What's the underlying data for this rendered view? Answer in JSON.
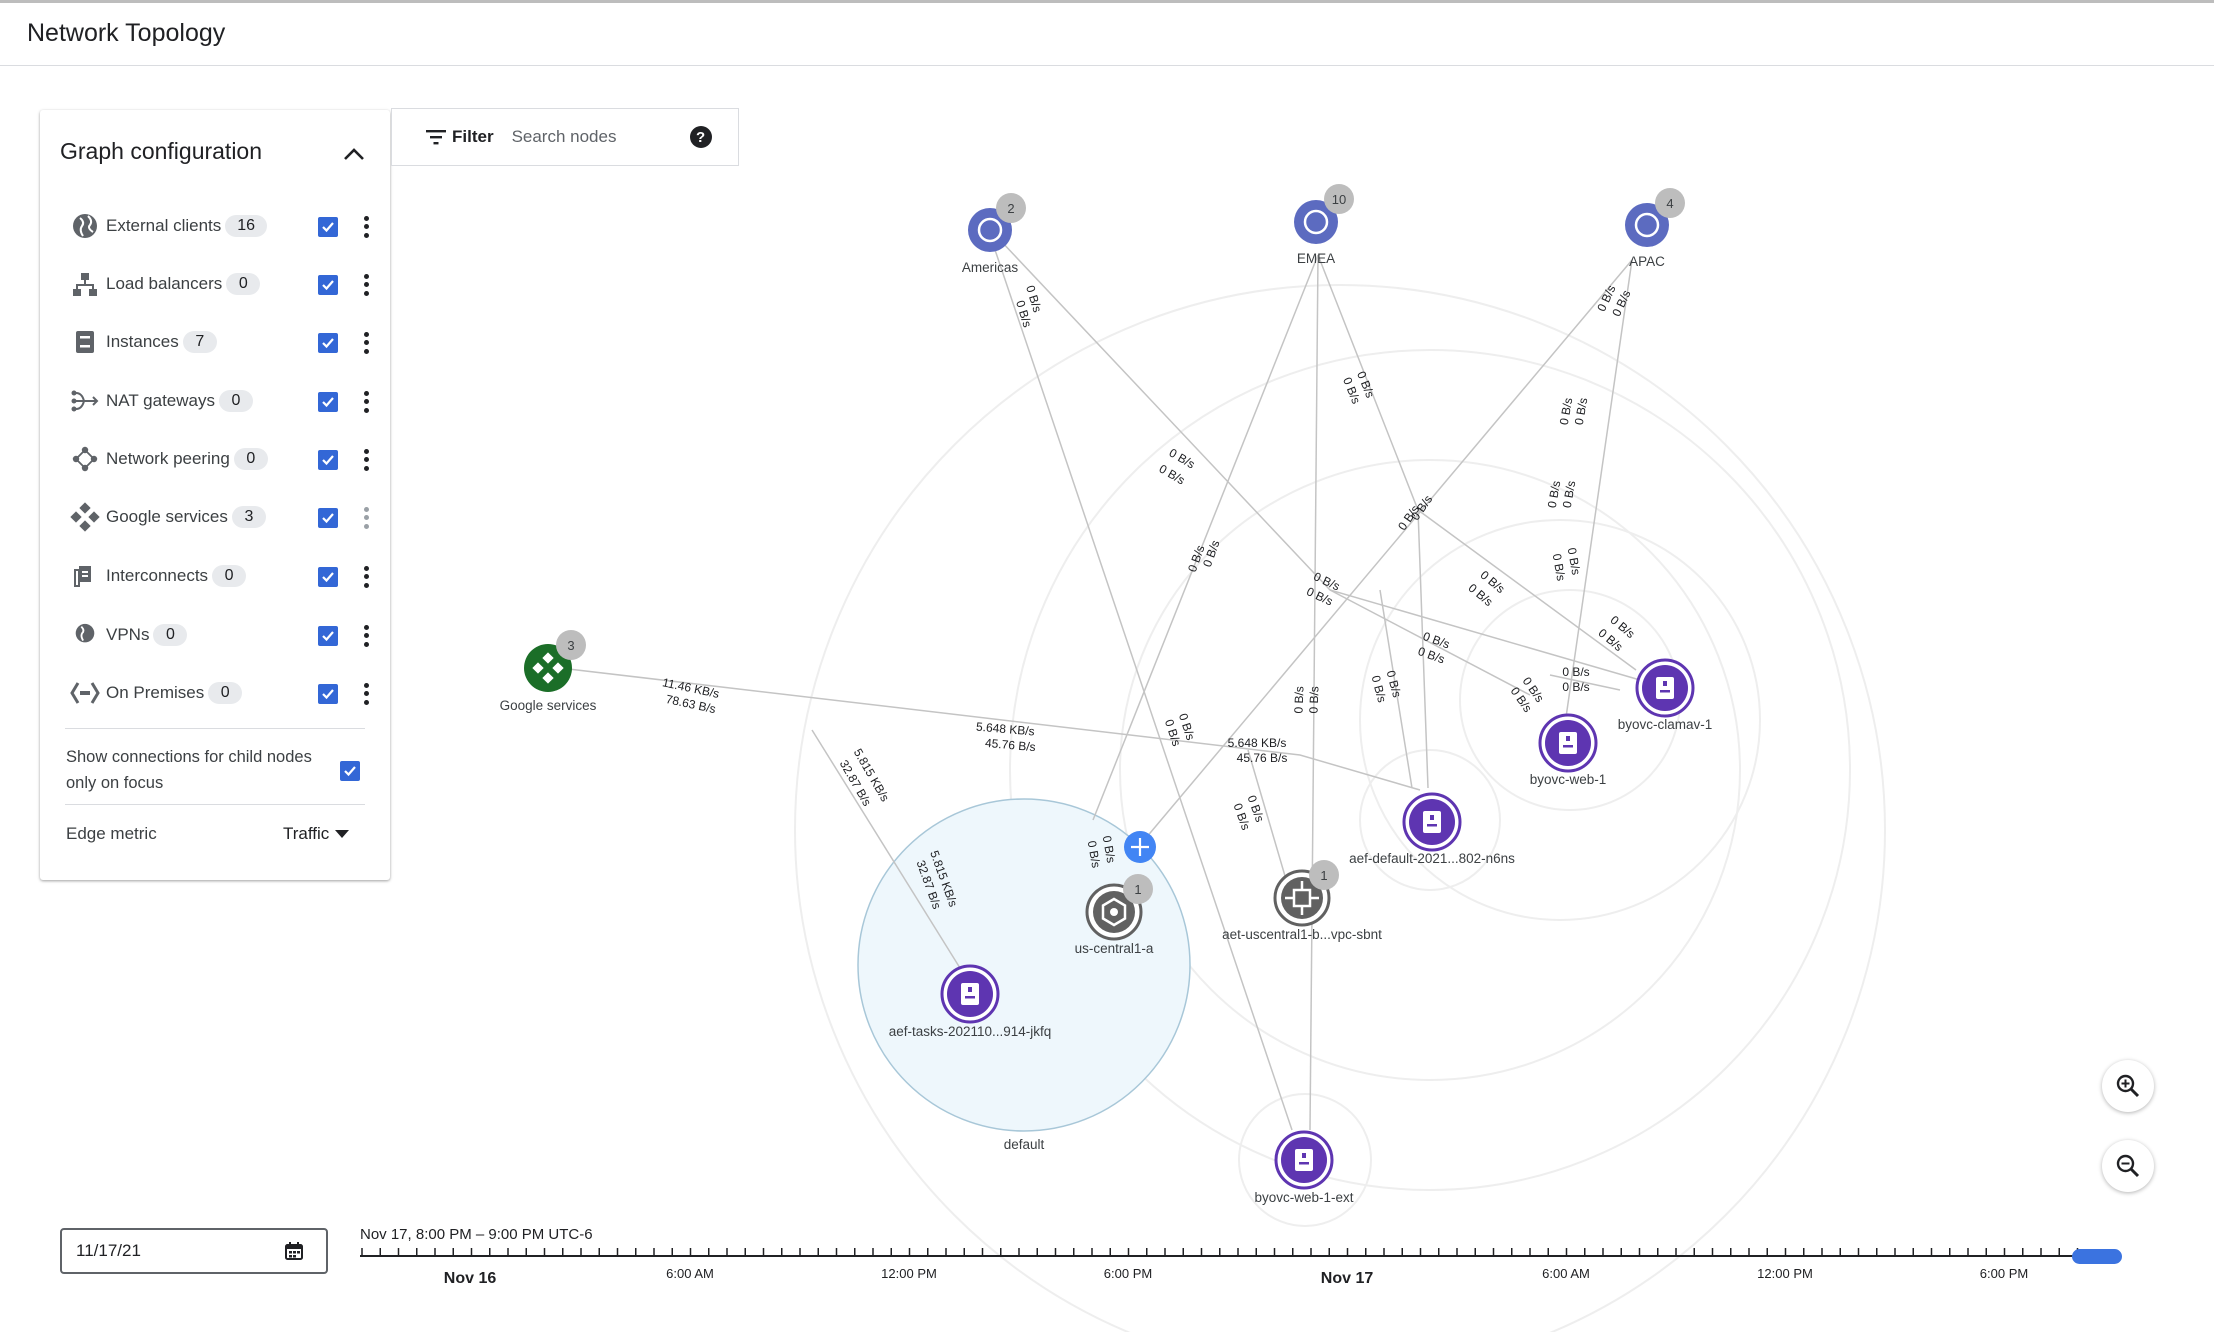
{
  "header": {
    "title": "Network Topology"
  },
  "config": {
    "title": "Graph configuration",
    "items": [
      {
        "label": "External clients",
        "count": "16",
        "checked": true
      },
      {
        "label": "Load balancers",
        "count": "0",
        "checked": true
      },
      {
        "label": "Instances",
        "count": "7",
        "checked": true
      },
      {
        "label": "NAT gateways",
        "count": "0",
        "checked": true
      },
      {
        "label": "Network peering",
        "count": "0",
        "checked": true
      },
      {
        "label": "Google services",
        "count": "3",
        "checked": true
      },
      {
        "label": "Interconnects",
        "count": "0",
        "checked": true
      },
      {
        "label": "VPNs",
        "count": "0",
        "checked": true
      },
      {
        "label": "On Premises",
        "count": "0",
        "checked": true
      }
    ],
    "child_nodes_label": "Show connections for child nodes only on focus",
    "edge_metric_label": "Edge metric",
    "edge_metric_value": "Traffic"
  },
  "filter": {
    "label": "Filter",
    "placeholder": "Search nodes",
    "help": "?"
  },
  "graph": {
    "regions": {
      "americas": {
        "label": "Americas",
        "count": "2"
      },
      "emea": {
        "label": "EMEA",
        "count": "10"
      },
      "apac": {
        "label": "APAC",
        "count": "4"
      }
    },
    "google_services": {
      "label": "Google services",
      "count": "3"
    },
    "zone": {
      "label": "us-central1-a",
      "count": "1"
    },
    "subnet": {
      "label": "aet-uscentral1-b...vpc-sbnt",
      "count": "1"
    },
    "network": {
      "label": "default"
    },
    "instances": {
      "aef_tasks": "aef-tasks-202110...914-jkfq",
      "aef_default": "aef-default-2021...802-n6ns",
      "byovc_web_1": "byovc-web-1",
      "byovc_clamav_1": "byovc-clamav-1",
      "byovc_web_1_ext": "byovc-web-1-ext"
    },
    "edge_labels": {
      "zero": "0 B/s",
      "gs_out": "11.46 KB/s",
      "gs_in": "78.63 B/s",
      "mid_out": "5.648 KB/s",
      "mid_in": "45.76 B/s",
      "task_out": "5.815 KB/s",
      "task_in": "32.87 B/s"
    }
  },
  "timeline": {
    "date": "11/17/21",
    "range": "Nov 17, 8:00 PM – 9:00 PM UTC-6",
    "ticks": [
      "Nov 16",
      "6:00 AM",
      "12:00 PM",
      "6:00 PM",
      "Nov 17",
      "6:00 AM",
      "12:00 PM",
      "6:00 PM"
    ]
  },
  "colors": {
    "instance": "#5e35b1",
    "region": "#5c6bc0",
    "google": "#1b6e28",
    "checkbox": "#3367d6",
    "network_fill": "#eef7fc"
  }
}
